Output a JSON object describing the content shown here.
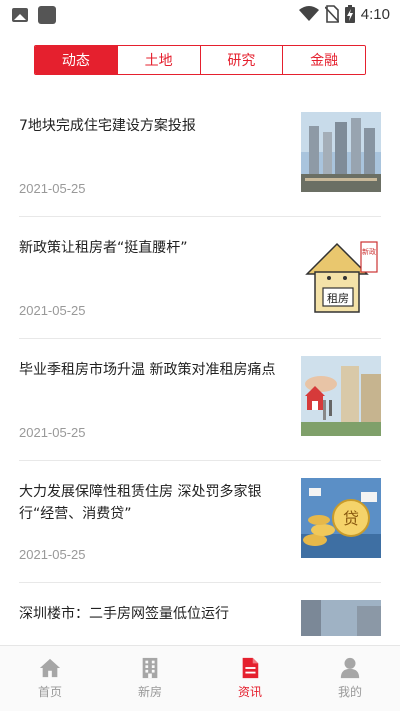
{
  "status_bar": {
    "time": "4:10",
    "left_icons": [
      "image-icon",
      "app-icon"
    ],
    "right_icons": [
      "wifi-icon",
      "no-sim-icon",
      "battery-charging-icon"
    ]
  },
  "tabs": [
    {
      "label": "动态",
      "active": true
    },
    {
      "label": "土地",
      "active": false
    },
    {
      "label": "研究",
      "active": false
    },
    {
      "label": "金融",
      "active": false
    }
  ],
  "news": [
    {
      "title": "7地块完成住宅建设方案投报",
      "date": "2021-05-25",
      "thumb": "city-buildings"
    },
    {
      "title": "新政策让租房者“挺直腰杆”",
      "date": "2021-05-25",
      "thumb": "cartoon-house-rent",
      "thumb_text": [
        "租房",
        "新政"
      ]
    },
    {
      "title": "毕业季租房市场升温 新政策对准租房痛点",
      "date": "2021-05-25",
      "thumb": "house-key"
    },
    {
      "title": "大力发展保障性租赁住房 深处罚多家银行“经营、消费贷”",
      "date": "2021-05-25",
      "thumb": "loan-coins",
      "thumb_text": [
        "贷"
      ]
    },
    {
      "title": "深圳楼市：二手房网签量低位运行",
      "date": "",
      "thumb": "building-partial"
    }
  ],
  "bottom_nav": [
    {
      "label": "首页",
      "icon": "home-icon",
      "active": false
    },
    {
      "label": "新房",
      "icon": "building-icon",
      "active": false
    },
    {
      "label": "资讯",
      "icon": "document-icon",
      "active": true
    },
    {
      "label": "我的",
      "icon": "user-icon",
      "active": false
    }
  ],
  "colors": {
    "accent": "#e5202e",
    "inactive": "#999999"
  }
}
